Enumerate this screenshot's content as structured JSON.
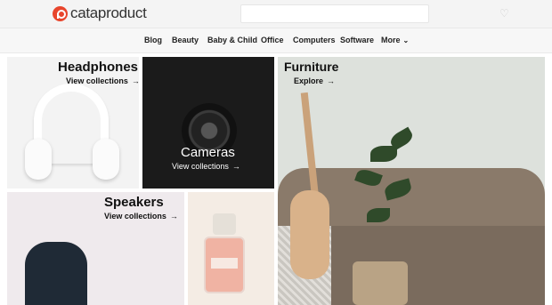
{
  "brand": {
    "name": "cataproduct",
    "accent": "#e8452c"
  },
  "search": {
    "placeholder": ""
  },
  "nav": {
    "items": [
      "Blog",
      "Beauty",
      "Baby & Child",
      "Office",
      "Computers",
      "Software"
    ],
    "more_label": "More",
    "more_icon": "chevron-down-icon"
  },
  "favorites_icon": "heart-icon",
  "tiles": {
    "headphones": {
      "title": "Headphones",
      "link": "View collections"
    },
    "cameras": {
      "title": "Cameras",
      "link": "View collections"
    },
    "furniture": {
      "title": "Furniture",
      "link": "Explore"
    },
    "speakers": {
      "title": "Speakers",
      "link": "View collections"
    }
  },
  "arrow_glyph": "→",
  "chevron_glyph": "⌄",
  "heart_glyph": "♡"
}
